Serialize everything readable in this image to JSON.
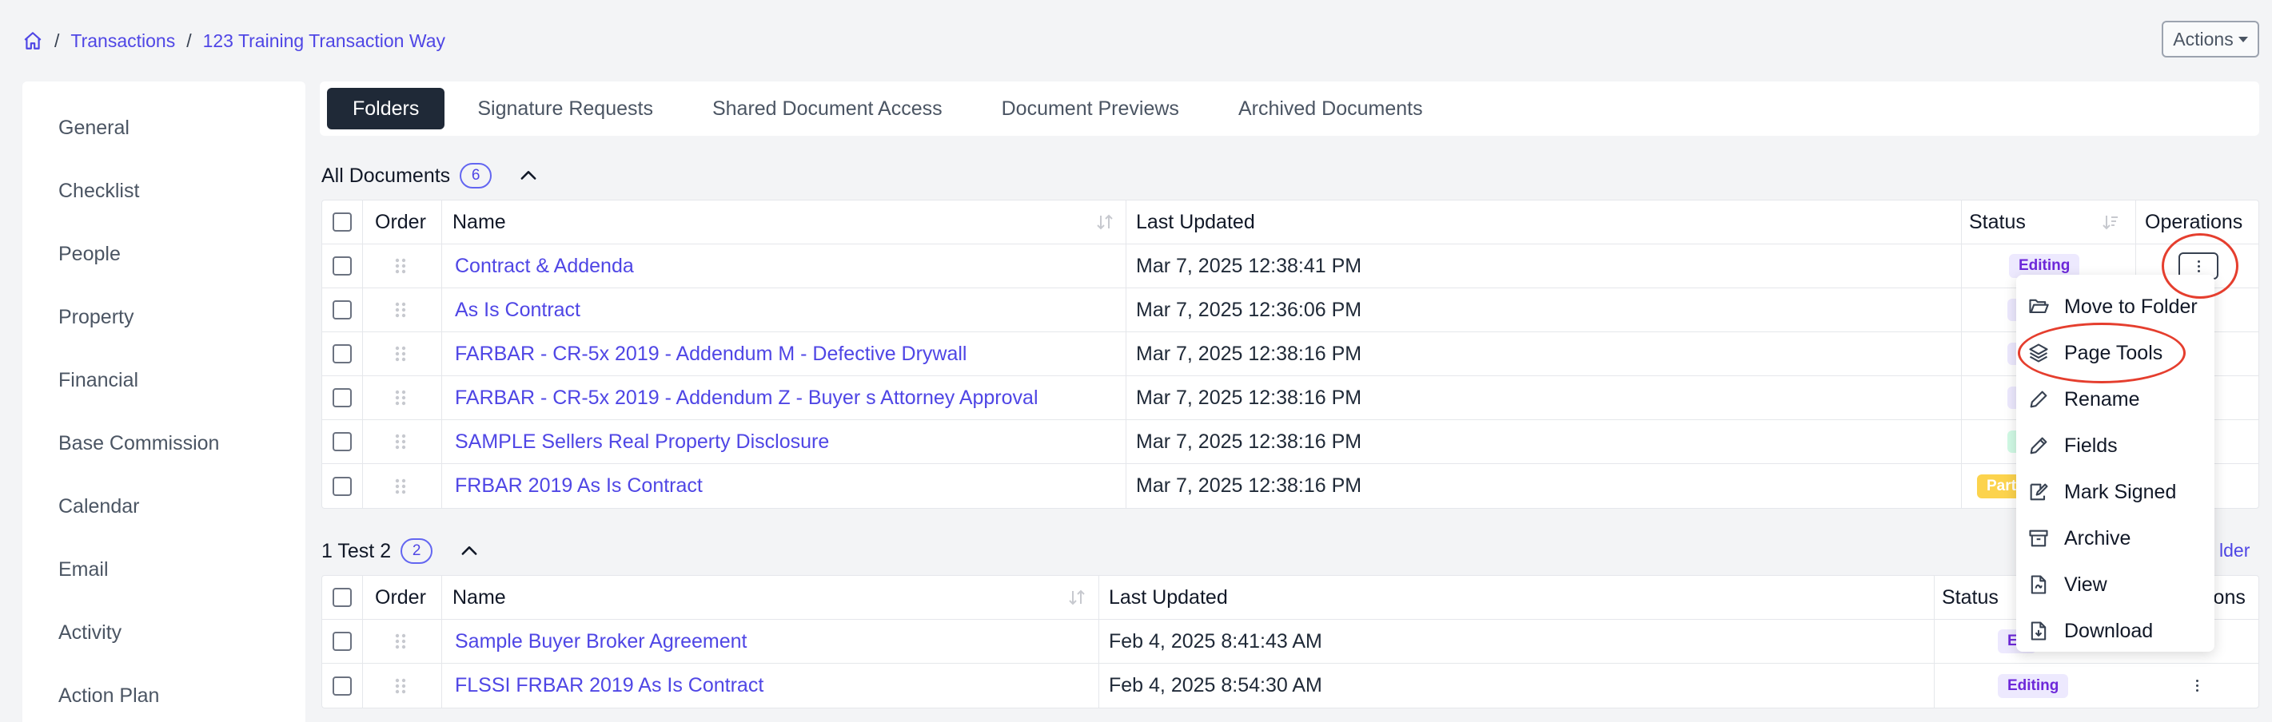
{
  "breadcrumb": {
    "sep1": "/",
    "link1": "Transactions",
    "sep2": "/",
    "link2": "123 Training Transaction Way"
  },
  "actions_label": "Actions",
  "sidebar": {
    "items": [
      "General",
      "Checklist",
      "People",
      "Property",
      "Financial",
      "Base Commission",
      "Calendar",
      "Email",
      "Activity",
      "Action Plan"
    ]
  },
  "tabs": [
    "Folders",
    "Signature Requests",
    "Shared Document Access",
    "Document Previews",
    "Archived Documents"
  ],
  "sections": [
    {
      "title": "All Documents",
      "count": "6",
      "columns": [
        "Order",
        "Name",
        "Last Updated",
        "Status",
        "Operations"
      ],
      "rows": [
        {
          "name": "Contract & Addenda",
          "updated": "Mar 7, 2025 12:38:41 PM",
          "status": "Editing"
        },
        {
          "name": "As Is Contract",
          "updated": "Mar 7, 2025 12:36:06 PM",
          "status": ""
        },
        {
          "name": "FARBAR - CR-5x 2019 - Addendum M - Defective Drywall",
          "updated": "Mar 7, 2025 12:38:16 PM",
          "status": ""
        },
        {
          "name": "FARBAR - CR-5x 2019 - Addendum Z - Buyer s Attorney Approval",
          "updated": "Mar 7, 2025 12:38:16 PM",
          "status": ""
        },
        {
          "name": "SAMPLE Sellers Real Property Disclosure",
          "updated": "Mar 7, 2025 12:38:16 PM",
          "status": ""
        },
        {
          "name": "FRBAR 2019 As Is Contract",
          "updated": "Mar 7, 2025 12:38:16 PM",
          "status": "Part"
        }
      ]
    },
    {
      "title": "1 Test 2",
      "count": "2",
      "columns": [
        "Order",
        "Name",
        "Last Updated",
        "Status",
        "ions"
      ],
      "rows": [
        {
          "name": "Sample Buyer Broker Agreement",
          "updated": "Feb 4, 2025 8:41:43 AM",
          "status": "Ed"
        },
        {
          "name": "FLSSI FRBAR 2019 As Is Contract",
          "updated": "Feb 4, 2025 8:54:30 AM",
          "status": "Editing"
        }
      ]
    }
  ],
  "add_folder_partial": "lder",
  "operations_menu": [
    "Move to Folder",
    "Page Tools",
    "Rename",
    "Fields",
    "Mark Signed",
    "Archive",
    "View",
    "Download"
  ],
  "colors": {
    "link": "#4f46e5",
    "active_tab": "#1f2937",
    "editing_badge_bg": "#ede9fe",
    "editing_badge_text": "#6d28d9",
    "partial_badge_bg": "#fcd34d",
    "annotation_red": "#e53e2e"
  }
}
